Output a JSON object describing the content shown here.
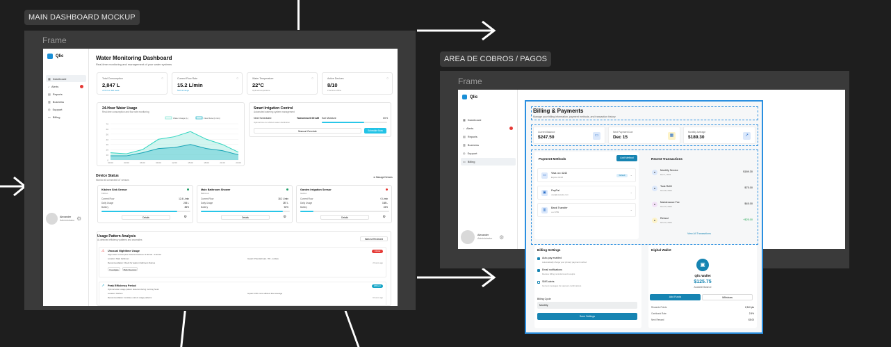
{
  "labels": {
    "main": "MAIN DASHBOARD MOCKUP",
    "billing": "AREA DE COBROS / PAGOS",
    "frame1": "Frame",
    "frame2": "Frame"
  },
  "brand": "Qlic",
  "nav": [
    {
      "label": "Dashboard",
      "icon": "grid-icon"
    },
    {
      "label": "Alerts",
      "icon": "bell-icon"
    },
    {
      "label": "Reports",
      "icon": "report-icon"
    },
    {
      "label": "Business",
      "icon": "building-icon"
    },
    {
      "label": "Support",
      "icon": "support-icon"
    },
    {
      "label": "Billing",
      "icon": "card-icon"
    }
  ],
  "user": {
    "name": "Alexander",
    "role": "Administrator"
  },
  "dashboard": {
    "title": "Water Monitoring Dashboard",
    "subtitle": "Real-time monitoring and management of your water systems",
    "stats": [
      {
        "label": "Total Consumption",
        "value": "2,847 L",
        "note": "+5% from last week"
      },
      {
        "label": "Current Flow Rate",
        "value": "15.2 L/min",
        "note": "Normal range"
      },
      {
        "label": "Water Temperature",
        "value": "22°C",
        "note": "Optimal temperature"
      },
      {
        "label": "Active Devices",
        "value": "8/10",
        "note": "2 devices offline"
      }
    ],
    "chart": {
      "title": "24-Hour Water Usage",
      "subtitle": "Real-time consumption and flow rate monitoring",
      "legend": [
        "Water Usage (L)",
        "Flow Rate (L/min)"
      ],
      "yticks": [
        "70",
        "60",
        "50",
        "40",
        "30",
        "20",
        "10",
        "0"
      ],
      "xticks": [
        "00:00",
        "03:00",
        "06:00",
        "09:00",
        "12:00",
        "15:00",
        "18:00",
        "21:00",
        "24:00"
      ]
    },
    "chart_data": {
      "type": "area",
      "x": [
        "00:00",
        "03:00",
        "06:00",
        "09:00",
        "12:00",
        "15:00",
        "18:00",
        "21:00",
        "24:00"
      ],
      "series": [
        {
          "name": "Water Usage (L)",
          "values": [
            14,
            12,
            20,
            40,
            45,
            55,
            40,
            30,
            15
          ]
        },
        {
          "name": "Flow Rate (L/min)",
          "values": [
            8,
            8,
            14,
            22,
            24,
            30,
            22,
            18,
            10
          ]
        }
      ],
      "ylim": [
        0,
        70
      ]
    },
    "irrigation": {
      "title": "Smart Irrigation Control",
      "subtitle": "Automated watering system management",
      "next_label": "Next Scheduled",
      "next_value": "Tomorrow 6:00 AM",
      "next_note": "Optimal time for efficient water distribution",
      "soil_label": "Soil Moisture",
      "soil_value": "65%",
      "soil": 0.65,
      "manual": "Manual Override",
      "start": "Schedule Now"
    },
    "devices_title": "Device Status",
    "devices_subtitle": "Monitor all connected IoT sensors",
    "manage": "Manage Devices",
    "devices": [
      {
        "name": "Kitchen Sink Sensor",
        "loc": "Kitchen",
        "dot": "#22a06b",
        "rows": [
          [
            "Current Flow",
            "12.4 L/min"
          ],
          [
            "Daily Usage",
            "245 L"
          ],
          [
            "Battery",
            "85%"
          ]
        ],
        "battery": 0.85,
        "btn": "Details"
      },
      {
        "name": "Main Bathroom Shower",
        "loc": "Bathroom",
        "dot": "#22a06b",
        "rows": [
          [
            "Current Flow",
            "18.2 L/min"
          ],
          [
            "Daily Usage",
            "287 L"
          ],
          [
            "Battery",
            "92%"
          ]
        ],
        "battery": 0.92,
        "btn": "Details"
      },
      {
        "name": "Garden Irrigation Sensor",
        "loc": "Garden",
        "dot": "#e53935",
        "rows": [
          [
            "Current Flow",
            "0 L/min"
          ],
          [
            "Daily Usage",
            "158 L"
          ],
          [
            "Battery",
            "15%"
          ]
        ],
        "battery": 0.15,
        "btn": "Details"
      }
    ],
    "usage_title": "Usage Pattern Analysis",
    "usage_subtitle": "AI-detected efficiency patterns and anomalies",
    "mark_all": "Mark All Reviewed",
    "patterns": [
      {
        "title": "Unusual Nighttime Usage",
        "desc": "High water consumption detected between 2:00 AM - 4:00 AM",
        "l1": "Location: Main bathroom",
        "r1": "Impact: Potential leak - 5% - surface",
        "l2": "Recommendation: Check for leaks in bathroom fixtures",
        "tag": "Critical",
        "tagc": "#e53935",
        "time": "2 hours ago",
        "b1": "Investigate",
        "b2": "Mark Resolved"
      },
      {
        "title": "Peak Efficiency Period",
        "desc": "Optimal water usage pattern detected during morning hours",
        "l1": "Location: Kitchen",
        "r1": "Impact: 15% more efficient than average",
        "l2": "Recommendation: Continue current usage patterns",
        "tag": "Efficient",
        "tagc": "#16a5c7",
        "time": "6 hours ago",
        "b1": "",
        "b2": ""
      }
    ]
  },
  "billing": {
    "title": "Billing & Payments",
    "subtitle": "Manage your billing information, payment methods, and transaction history",
    "stats": [
      {
        "label": "Current Balance",
        "value": "$247.50"
      },
      {
        "label": "Next Payment Due",
        "value": "Dec 15"
      },
      {
        "label": "Monthly Average",
        "value": "$189.30"
      }
    ],
    "pm_title": "Payment Methods",
    "add_method": "Add Method",
    "methods": [
      {
        "name": "Visa •••• 4242",
        "sub": "Expires 12/25",
        "tag": "Default"
      },
      {
        "name": "PayPal",
        "sub": "user@example.com",
        "tag": ""
      },
      {
        "name": "Bank Transfer",
        "sub": "•••• 6789",
        "tag": ""
      }
    ],
    "tx_title": "Recent Transactions",
    "tx": [
      {
        "name": "Monthly Service",
        "date": "Dec 1, 2024",
        "amt": "$189.30",
        "c": "#111"
      },
      {
        "name": "Tank Refill",
        "date": "Nov 28, 2024",
        "amt": "$75.00",
        "c": "#111"
      },
      {
        "name": "Maintenance Fee",
        "date": "Nov 15, 2024",
        "amt": "$45.00",
        "c": "#111"
      },
      {
        "name": "Refund",
        "date": "Nov 10, 2024",
        "amt": "+$25.00",
        "c": "#16a34a"
      }
    ],
    "view_all": "View All Transactions",
    "bs_title": "Billing Settings",
    "settings": [
      {
        "label": "Auto-pay enabled",
        "sub": "Automatically charge your primary payment method"
      },
      {
        "label": "Email notifications",
        "sub": "Receive billing reminders and receipts"
      },
      {
        "label": "SMS alerts",
        "sub": "Get text messages for payment confirmations"
      }
    ],
    "cycle_label": "Billing Cycle",
    "cycle_value": "Monthly",
    "save": "Save Settings",
    "wallet_title": "Digital Wallet",
    "wallet_name": "Qlic Wallet",
    "wallet_amount": "$125.75",
    "wallet_note": "Available Balance",
    "add_funds": "Add Funds",
    "withdraw": "Withdraw",
    "wallet_rows": [
      [
        "Rewards Points",
        "2,340 pts"
      ],
      [
        "Cashback Rate",
        "2.5%"
      ],
      [
        "Next Reward",
        "$5.00"
      ]
    ]
  }
}
